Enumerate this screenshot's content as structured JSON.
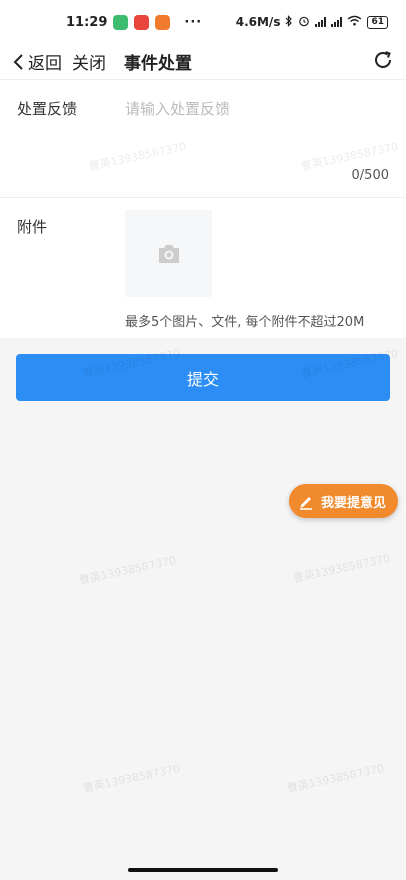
{
  "status_bar": {
    "time": "11:29",
    "dots": "···",
    "speed": "4.6M/s",
    "battery": "61"
  },
  "nav": {
    "back_label": "返回",
    "close_label": "关闭",
    "title": "事件处置"
  },
  "form": {
    "feedback_label": "处置反馈",
    "feedback_placeholder": "请输入处置反馈",
    "feedback_counter": "0/500",
    "attach_label": "附件",
    "attach_hint": "最多5个图片、文件, 每个附件不超过20M"
  },
  "submit_label": "提交",
  "fab_label": "我要提意见",
  "watermark_text": "曹英13938587370",
  "colors": {
    "accent": "#2c8ef5",
    "fab": "#f08a2c"
  }
}
